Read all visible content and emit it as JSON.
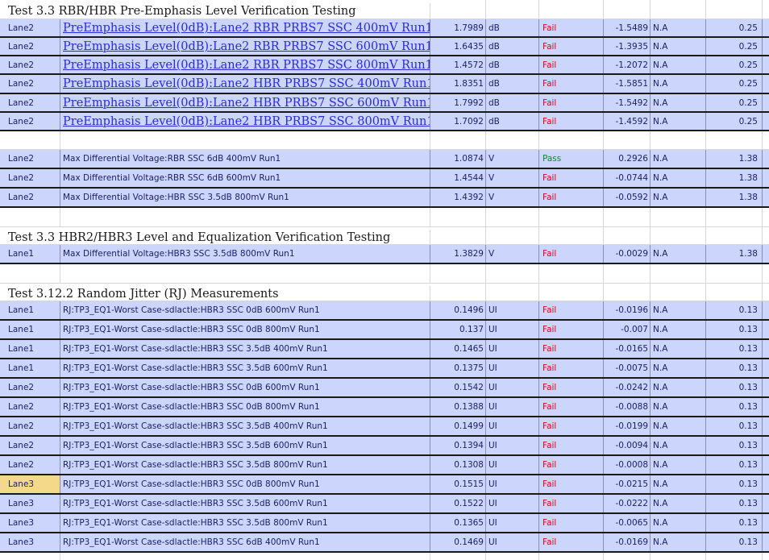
{
  "sections": [
    {
      "title": "Test 3.3  RBR/HBR Pre-Emphasis Level Verification Testing",
      "rows": [
        {
          "lane": "Lane2",
          "name": "PreEmphasis Level(0dB):Lane2 RBR PRBS7 SSC 400mV  Run1",
          "value": "1.7989",
          "unit": "dB",
          "result": "Fail",
          "margin": "-1.5489",
          "na": "N.A",
          "limit": "0.25"
        },
        {
          "lane": "Lane2",
          "name": "PreEmphasis Level(0dB):Lane2 RBR PRBS7 SSC 600mV  Run1",
          "value": "1.6435",
          "unit": "dB",
          "result": "Fail",
          "margin": "-1.3935",
          "na": "N.A",
          "limit": "0.25"
        },
        {
          "lane": "Lane2",
          "name": "PreEmphasis Level(0dB):Lane2 RBR PRBS7 SSC 800mV  Run1",
          "value": "1.4572",
          "unit": "dB",
          "result": "Fail",
          "margin": "-1.2072",
          "na": "N.A",
          "limit": "0.25"
        },
        {
          "lane": "Lane2",
          "name": "PreEmphasis Level(0dB):Lane2 HBR PRBS7 SSC 400mV  Run1",
          "value": "1.8351",
          "unit": "dB",
          "result": "Fail",
          "margin": "-1.5851",
          "na": "N.A",
          "limit": "0.25"
        },
        {
          "lane": "Lane2",
          "name": "PreEmphasis Level(0dB):Lane2 HBR PRBS7 SSC 600mV  Run1",
          "value": "1.7992",
          "unit": "dB",
          "result": "Fail",
          "margin": "-1.5492",
          "na": "N.A",
          "limit": "0.25"
        },
        {
          "lane": "Lane2",
          "name": "PreEmphasis Level(0dB):Lane2 HBR PRBS7 SSC 800mV  Run1",
          "value": "1.7092",
          "unit": "dB",
          "result": "Fail",
          "margin": "-1.4592",
          "na": "N.A",
          "limit": "0.25"
        }
      ]
    },
    {
      "title": "",
      "rows": [
        {
          "lane": "Lane2",
          "name": "Max Differential Voltage:RBR SSC 6dB 400mV Run1",
          "value": "1.0874",
          "unit": "V",
          "result": "Pass",
          "margin": "0.2926",
          "na": "N.A",
          "limit": "1.38"
        },
        {
          "lane": "Lane2",
          "name": "Max Differential Voltage:RBR SSC 6dB 600mV Run1",
          "value": "1.4544",
          "unit": "V",
          "result": "Fail",
          "margin": "-0.0744",
          "na": "N.A",
          "limit": "1.38"
        },
        {
          "lane": "Lane2",
          "name": "Max Differential Voltage:HBR SSC 3.5dB 800mV Run1",
          "value": "1.4392",
          "unit": "V",
          "result": "Fail",
          "margin": "-0.0592",
          "na": "N.A",
          "limit": "1.38"
        }
      ]
    },
    {
      "title": "Test 3.3  HBR2/HBR3 Level and Equalization Verification Testing",
      "rows": [
        {
          "lane": "Lane1",
          "name": "Max Differential Voltage:HBR3 SSC 3.5dB 800mV Run1",
          "value": "1.3829",
          "unit": "V",
          "result": "Fail",
          "margin": "-0.0029",
          "na": "N.A",
          "limit": "1.38"
        }
      ]
    },
    {
      "title": "Test 3.12.2  Random Jitter (RJ) Measurements",
      "rows": [
        {
          "lane": "Lane1",
          "name": "RJ:TP3_EQ1-Worst Case-sdlactle:HBR3 SSC 0dB 600mV Run1",
          "value": "0.1496",
          "unit": "UI",
          "result": "Fail",
          "margin": "-0.0196",
          "na": "N.A",
          "limit": "0.13"
        },
        {
          "lane": "Lane1",
          "name": "RJ:TP3_EQ1-Worst Case-sdlactle:HBR3 SSC 0dB 800mV Run1",
          "value": "0.137",
          "unit": "UI",
          "result": "Fail",
          "margin": "-0.007",
          "na": "N.A",
          "limit": "0.13"
        },
        {
          "lane": "Lane1",
          "name": "RJ:TP3_EQ1-Worst Case-sdlactle:HBR3 SSC 3.5dB 400mV Run1",
          "value": "0.1465",
          "unit": "UI",
          "result": "Fail",
          "margin": "-0.0165",
          "na": "N.A",
          "limit": "0.13"
        },
        {
          "lane": "Lane1",
          "name": "RJ:TP3_EQ1-Worst Case-sdlactle:HBR3 SSC 3.5dB 600mV Run1",
          "value": "0.1375",
          "unit": "UI",
          "result": "Fail",
          "margin": "-0.0075",
          "na": "N.A",
          "limit": "0.13"
        },
        {
          "lane": "Lane2",
          "name": "RJ:TP3_EQ1-Worst Case-sdlactle:HBR3 SSC 0dB 600mV Run1",
          "value": "0.1542",
          "unit": "UI",
          "result": "Fail",
          "margin": "-0.0242",
          "na": "N.A",
          "limit": "0.13"
        },
        {
          "lane": "Lane2",
          "name": "RJ:TP3_EQ1-Worst Case-sdlactle:HBR3 SSC 0dB 800mV Run1",
          "value": "0.1388",
          "unit": "UI",
          "result": "Fail",
          "margin": "-0.0088",
          "na": "N.A",
          "limit": "0.13"
        },
        {
          "lane": "Lane2",
          "name": "RJ:TP3_EQ1-Worst Case-sdlactle:HBR3 SSC 3.5dB 400mV Run1",
          "value": "0.1499",
          "unit": "UI",
          "result": "Fail",
          "margin": "-0.0199",
          "na": "N.A",
          "limit": "0.13"
        },
        {
          "lane": "Lane2",
          "name": "RJ:TP3_EQ1-Worst Case-sdlactle:HBR3 SSC 3.5dB 600mV Run1",
          "value": "0.1394",
          "unit": "UI",
          "result": "Fail",
          "margin": "-0.0094",
          "na": "N.A",
          "limit": "0.13"
        },
        {
          "lane": "Lane2",
          "name": "RJ:TP3_EQ1-Worst Case-sdlactle:HBR3 SSC 3.5dB 800mV Run1",
          "value": "0.1308",
          "unit": "UI",
          "result": "Fail",
          "margin": "-0.0008",
          "na": "N.A",
          "limit": "0.13"
        },
        {
          "lane": "Lane3",
          "name": "RJ:TP3_EQ1-Worst Case-sdlactle:HBR3 SSC 0dB 800mV Run1",
          "value": "0.1515",
          "unit": "UI",
          "result": "Fail",
          "margin": "-0.0215",
          "na": "N.A",
          "limit": "0.13"
        },
        {
          "lane": "Lane3",
          "name": "RJ:TP3_EQ1-Worst Case-sdlactle:HBR3 SSC 3.5dB 600mV Run1",
          "value": "0.1522",
          "unit": "UI",
          "result": "Fail",
          "margin": "-0.0222",
          "na": "N.A",
          "limit": "0.13"
        },
        {
          "lane": "Lane3",
          "name": "RJ:TP3_EQ1-Worst Case-sdlactle:HBR3 SSC 3.5dB 800mV Run1",
          "value": "0.1365",
          "unit": "UI",
          "result": "Fail",
          "margin": "-0.0065",
          "na": "N.A",
          "limit": "0.13"
        },
        {
          "lane": "Lane3",
          "name": "RJ:TP3_EQ1-Worst Case-sdlactle:HBR3 SSC 6dB 400mV Run1",
          "value": "0.1469",
          "unit": "UI",
          "result": "Fail",
          "margin": "-0.0169",
          "na": "N.A",
          "limit": "0.13"
        }
      ]
    }
  ],
  "colors": {
    "row_fill": "#ccd5fb",
    "fail_text": "#e0001b",
    "pass_text": "#0a8a2a",
    "link_text": "#2b2bd8",
    "cell_text": "#1a1f66"
  }
}
